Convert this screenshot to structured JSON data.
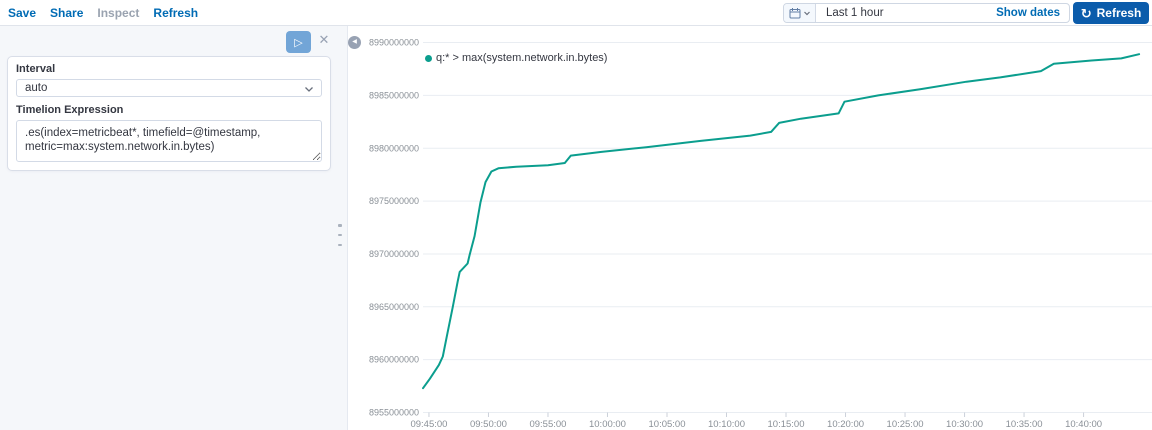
{
  "topbar": {
    "nav": [
      {
        "label": "Save",
        "enabled": true
      },
      {
        "label": "Share",
        "enabled": true
      },
      {
        "label": "Inspect",
        "enabled": false
      },
      {
        "label": "Refresh",
        "enabled": true
      }
    ],
    "datepicker": {
      "value": "Last 1 hour",
      "show_dates_label": "Show dates",
      "calendar_icon": "calendar",
      "chevron_icon": "chevron-down"
    },
    "refresh_button": {
      "label": "Refresh",
      "icon": "refresh-arrow",
      "bg_color": "#0b5cab"
    }
  },
  "editor": {
    "play_icon": "play",
    "close_icon": "close",
    "interval_label": "Interval",
    "interval_value": "auto",
    "expression_label": "Timelion Expression",
    "expression_value": ".es(index=metricbeat*, timefield=@timestamp,\nmetric=max:system.network.in.bytes)"
  },
  "chart_data": {
    "type": "line",
    "title": "",
    "legend_position": "top-left",
    "grid": "horizontal",
    "ylim": [
      8955000000,
      8990000000
    ],
    "y_ticks": [
      8955000000,
      8960000000,
      8965000000,
      8970000000,
      8975000000,
      8980000000,
      8985000000,
      8990000000
    ],
    "x_ticks": [
      "09:45:00",
      "09:50:00",
      "09:55:00",
      "10:00:00",
      "10:05:00",
      "10:10:00",
      "10:15:00",
      "10:20:00",
      "10:25:00",
      "10:30:00",
      "10:35:00",
      "10:40:00"
    ],
    "xlim": [
      "09:44:30",
      "10:45:50"
    ],
    "series": [
      {
        "name": "q:* > max(system.network.in.bytes)",
        "color": "#0b9e8e",
        "points": [
          [
            "09:44:30",
            8957300000
          ],
          [
            "09:45:05",
            8958200000
          ],
          [
            "09:45:50",
            8959500000
          ],
          [
            "09:46:10",
            8960300000
          ],
          [
            "09:46:30",
            8962200000
          ],
          [
            "09:47:00",
            8965000000
          ],
          [
            "09:47:25",
            8967400000
          ],
          [
            "09:47:35",
            8968300000
          ],
          [
            "09:48:15",
            8969100000
          ],
          [
            "09:48:25",
            8969900000
          ],
          [
            "09:48:50",
            8971700000
          ],
          [
            "09:49:20",
            8974900000
          ],
          [
            "09:49:45",
            8976800000
          ],
          [
            "09:50:15",
            8977800000
          ],
          [
            "09:50:50",
            8978100000
          ],
          [
            "09:52:20",
            8978250000
          ],
          [
            "09:55:00",
            8978400000
          ],
          [
            "09:56:25",
            8978600000
          ],
          [
            "09:56:55",
            8979300000
          ],
          [
            "09:59:30",
            8979650000
          ],
          [
            "10:03:15",
            8980100000
          ],
          [
            "10:07:50",
            8980700000
          ],
          [
            "10:12:00",
            8981200000
          ],
          [
            "10:13:45",
            8981550000
          ],
          [
            "10:14:25",
            8982400000
          ],
          [
            "10:16:15",
            8982800000
          ],
          [
            "10:19:25",
            8983300000
          ],
          [
            "10:19:55",
            8984400000
          ],
          [
            "10:22:45",
            8985000000
          ],
          [
            "10:26:20",
            8985600000
          ],
          [
            "10:30:10",
            8986300000
          ],
          [
            "10:33:00",
            8986700000
          ],
          [
            "10:36:25",
            8987300000
          ],
          [
            "10:37:30",
            8988000000
          ],
          [
            "10:40:40",
            8988300000
          ],
          [
            "10:43:10",
            8988500000
          ],
          [
            "10:44:40",
            8988900000
          ]
        ]
      }
    ],
    "axis_colors": {
      "grid": "#e9edf2",
      "tick": "#ccd1da",
      "label": "#8a9097"
    }
  }
}
